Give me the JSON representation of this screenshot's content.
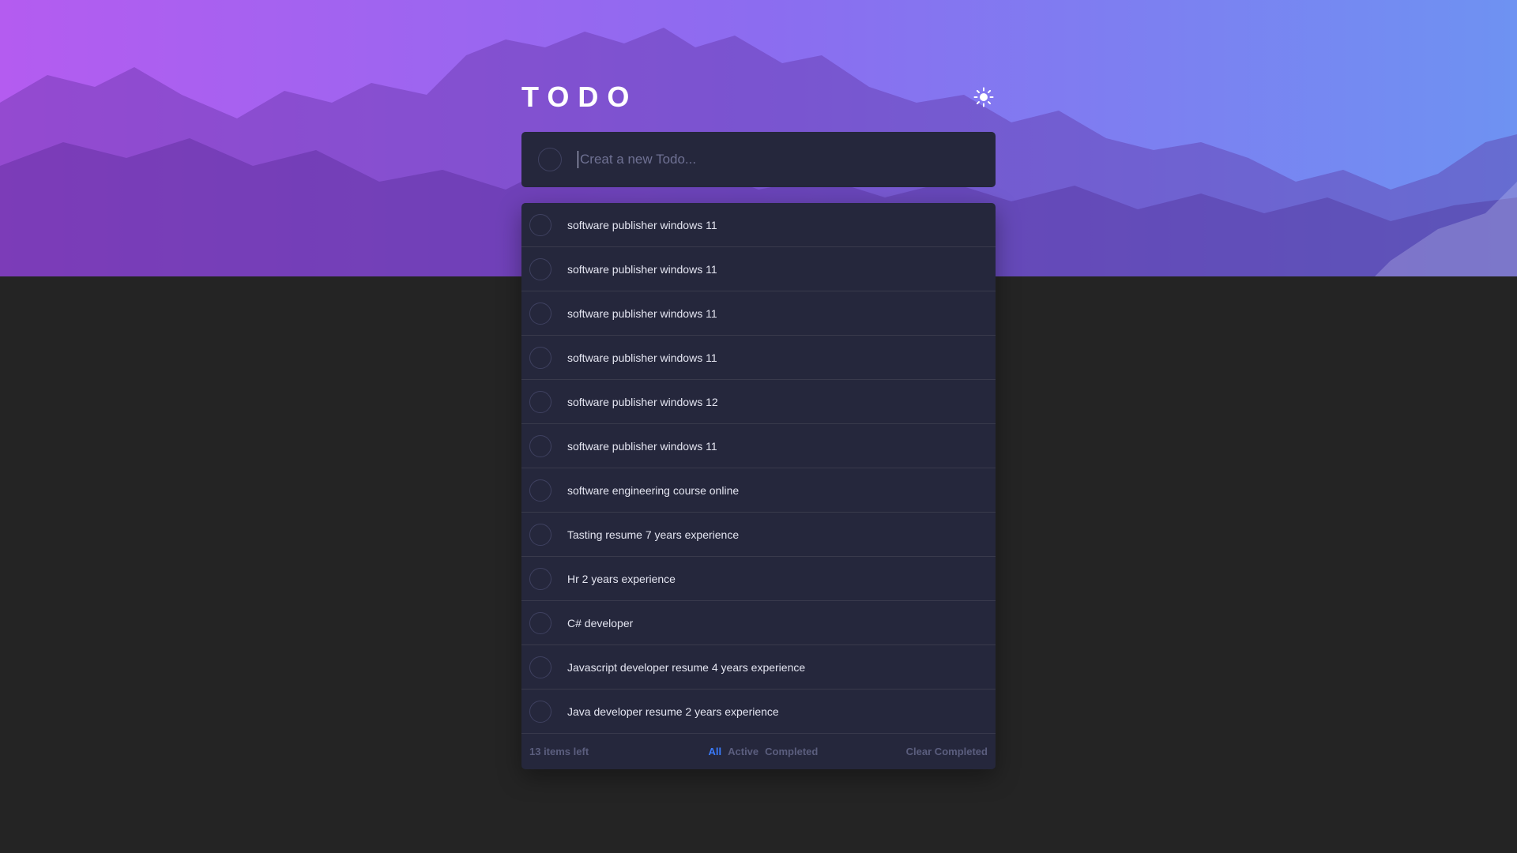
{
  "header": {
    "title": "TODO",
    "theme_icon": "sun-icon"
  },
  "new_todo": {
    "placeholder": "Creat a new Todo..."
  },
  "todos": [
    {
      "text": "software publisher windows 11"
    },
    {
      "text": "software publisher windows 11"
    },
    {
      "text": "software publisher windows 11"
    },
    {
      "text": "software publisher windows 11"
    },
    {
      "text": "software publisher windows 12"
    },
    {
      "text": "software publisher windows 11"
    },
    {
      "text": "software engineering course online"
    },
    {
      "text": "Tasting resume 7 years experience"
    },
    {
      "text": "Hr 2 years experience"
    },
    {
      "text": "C# developer"
    },
    {
      "text": "Javascript developer resume 4 years experience"
    },
    {
      "text": "Java developer resume 2 years experience"
    }
  ],
  "footer": {
    "items_left": "13 items left",
    "filter_all": "All",
    "filter_active": "Active",
    "filter_completed": "Completed",
    "clear_completed": "Clear Completed"
  },
  "colors": {
    "accent": "#3a7bfd",
    "card": "#25273c",
    "page_bg": "#242424"
  }
}
